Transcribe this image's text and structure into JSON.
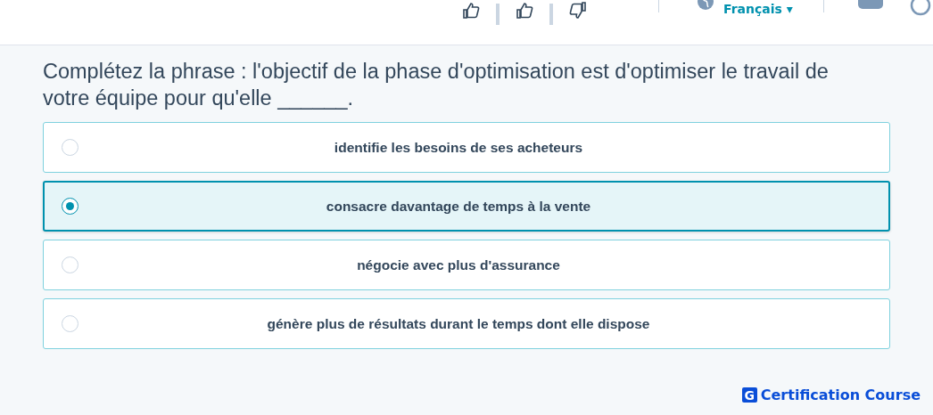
{
  "toolbar": {
    "language": "Français",
    "language_caret": "▾"
  },
  "question": "Complétez la phrase : l'objectif de la phase d'optimisation est d'optimiser le travail de votre équipe pour qu'elle ______.",
  "options": [
    {
      "label": "identifie les besoins de ses acheteurs",
      "selected": false
    },
    {
      "label": "consacre davantage de temps à la vente",
      "selected": true
    },
    {
      "label": "négocie avec plus d'assurance",
      "selected": false
    },
    {
      "label": "génère plus de résultats durant le temps dont elle dispose",
      "selected": false
    }
  ],
  "brand": {
    "logo_letter": "G",
    "name": "Certification Course"
  }
}
